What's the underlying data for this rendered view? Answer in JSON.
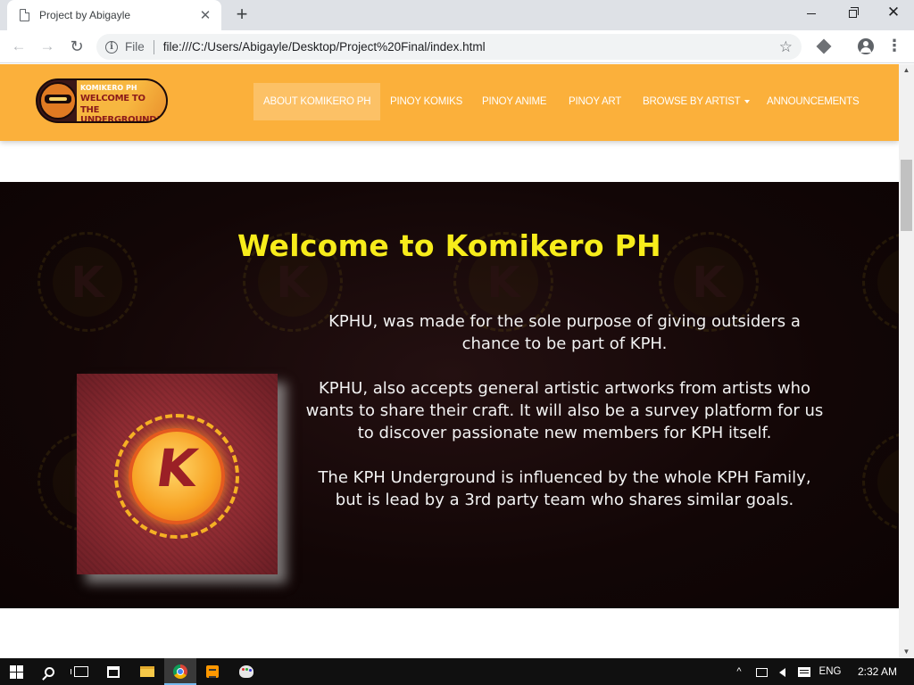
{
  "browser": {
    "tab_title": "Project by Abigayle",
    "tab_close": "✕",
    "new_tab": "+",
    "window_close": "✕",
    "scheme_label": "File",
    "url": "file:///C:/Users/Abigayle/Desktop/Project%20Final/index.html",
    "nav_back": "←",
    "nav_forward": "→",
    "reload": "↻",
    "info": "i",
    "bookmark_star": "☆",
    "menu": "⋮"
  },
  "site": {
    "logo": {
      "line1": "KOMIKERO PH",
      "line2": "WELCOME TO",
      "line3": "THE UNDERGROUND!"
    },
    "nav": [
      {
        "label": "About Komikero PH",
        "active": true
      },
      {
        "label": "Pinoy Komiks"
      },
      {
        "label": "Pinoy Anime"
      },
      {
        "label": "Pinoy Art"
      },
      {
        "label": "Browse by Artist"
      },
      {
        "label": "Announcements"
      }
    ],
    "hero": {
      "title": "Welcome to Komikero PH",
      "emblem_letter": "K",
      "paragraphs": [
        "KPHU, was made for the sole purpose of giving outsiders a chance to be part of KPH.",
        "KPHU, also accepts general artistic artworks from artists who wants to share their craft. It will also be a survey platform for us to discover passionate new members for KPH itself.",
        "The KPH Underground is influenced by the whole KPH Family, but is lead by a 3rd party team who shares similar goals."
      ]
    }
  },
  "taskbar": {
    "tray_chevron": "^",
    "language": "ENG",
    "time": "2:32 AM"
  },
  "colors": {
    "navbar": "#fbb03b",
    "hero_title": "#f7ec1b",
    "hero_bg": "#120606"
  }
}
